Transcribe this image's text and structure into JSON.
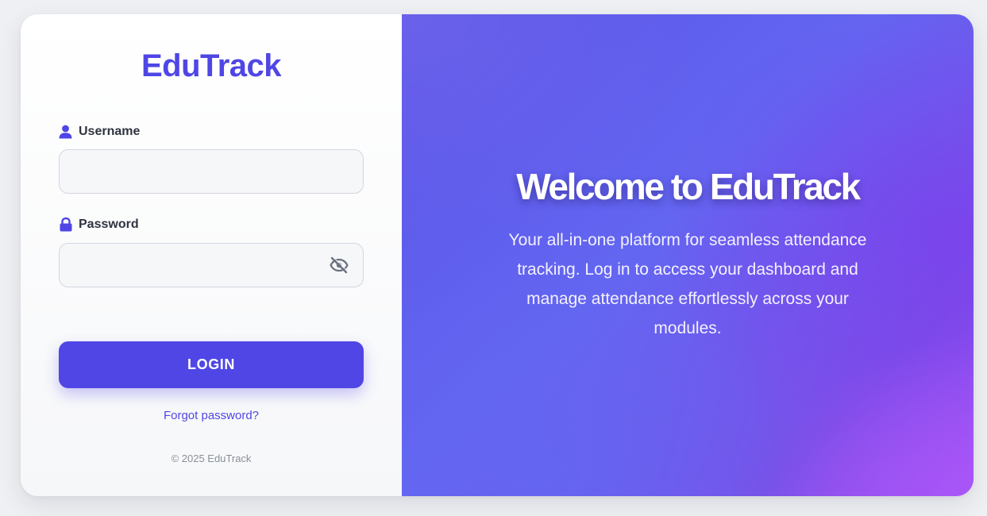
{
  "login_panel": {
    "brand": "EduTrack",
    "username": {
      "label": "Username",
      "value": "",
      "icon": "user-icon"
    },
    "password": {
      "label": "Password",
      "value": "",
      "icon": "lock-icon",
      "toggle_icon": "eye-off-icon"
    },
    "login_label": "LOGIN",
    "forgot_label": "Forgot password?",
    "footer": "© 2025 EduTrack"
  },
  "welcome_panel": {
    "title": "Welcome to EduTrack",
    "description": "Your all-in-one platform for seamless attendance tracking. Log in to access your dashboard and manage attendance effortlessly across your modules."
  },
  "colors": {
    "accent": "#4f46e5",
    "gradient_start": "#5a54e8",
    "gradient_end": "#a855f7",
    "page_background": "#eef0f3"
  }
}
